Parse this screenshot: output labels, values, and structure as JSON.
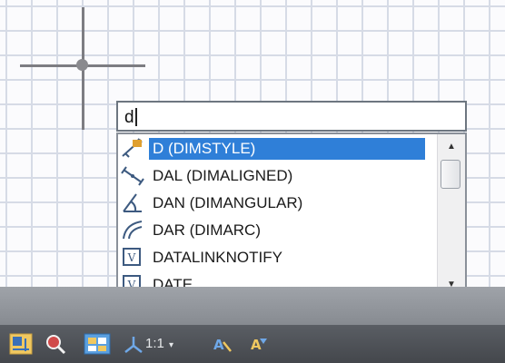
{
  "command_input": {
    "value": "d"
  },
  "autocomplete": {
    "items": [
      {
        "label": "D (DIMSTYLE)",
        "icon": "dimstyle-icon",
        "selected": true
      },
      {
        "label": "DAL (DIMALIGNED)",
        "icon": "dim-aligned-icon",
        "selected": false
      },
      {
        "label": "DAN (DIMANGULAR)",
        "icon": "dim-angular-icon",
        "selected": false
      },
      {
        "label": "DAR (DIMARC)",
        "icon": "dim-arc-icon",
        "selected": false
      },
      {
        "label": "DATALINKNOTIFY",
        "icon": "system-variable-icon",
        "selected": false
      },
      {
        "label": "DATE",
        "icon": "system-variable-icon",
        "selected": false
      }
    ]
  },
  "status_bar": {
    "annotation_scale": "1:1",
    "scale_dropdown_glyph": "▾"
  },
  "colors": {
    "selection": "#2f7fd8",
    "status_bar": "#4d5055",
    "command_area": "#93979d",
    "grid_line": "#d6dbe6"
  }
}
